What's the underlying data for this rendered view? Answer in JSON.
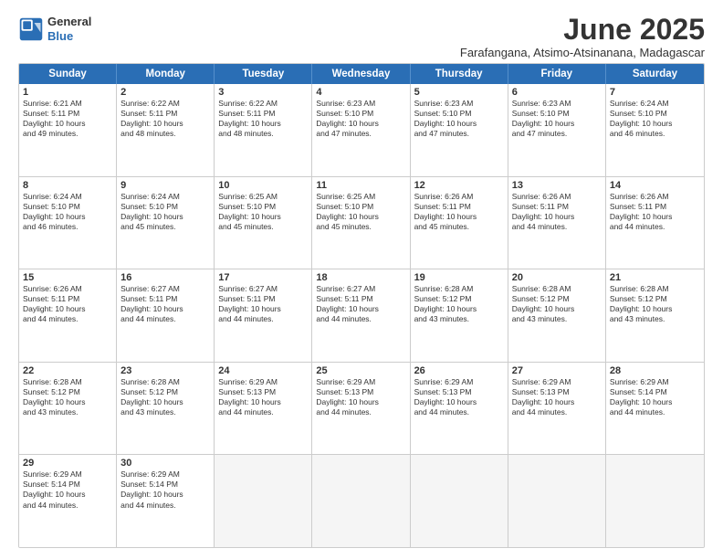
{
  "logo": {
    "general": "General",
    "blue": "Blue"
  },
  "title": "June 2025",
  "subtitle": "Farafangana, Atsimo-Atsinanana, Madagascar",
  "header_days": [
    "Sunday",
    "Monday",
    "Tuesday",
    "Wednesday",
    "Thursday",
    "Friday",
    "Saturday"
  ],
  "weeks": [
    [
      {
        "day": "1",
        "lines": [
          "Sunrise: 6:21 AM",
          "Sunset: 5:11 PM",
          "Daylight: 10 hours",
          "and 49 minutes."
        ]
      },
      {
        "day": "2",
        "lines": [
          "Sunrise: 6:22 AM",
          "Sunset: 5:11 PM",
          "Daylight: 10 hours",
          "and 48 minutes."
        ]
      },
      {
        "day": "3",
        "lines": [
          "Sunrise: 6:22 AM",
          "Sunset: 5:11 PM",
          "Daylight: 10 hours",
          "and 48 minutes."
        ]
      },
      {
        "day": "4",
        "lines": [
          "Sunrise: 6:23 AM",
          "Sunset: 5:10 PM",
          "Daylight: 10 hours",
          "and 47 minutes."
        ]
      },
      {
        "day": "5",
        "lines": [
          "Sunrise: 6:23 AM",
          "Sunset: 5:10 PM",
          "Daylight: 10 hours",
          "and 47 minutes."
        ]
      },
      {
        "day": "6",
        "lines": [
          "Sunrise: 6:23 AM",
          "Sunset: 5:10 PM",
          "Daylight: 10 hours",
          "and 47 minutes."
        ]
      },
      {
        "day": "7",
        "lines": [
          "Sunrise: 6:24 AM",
          "Sunset: 5:10 PM",
          "Daylight: 10 hours",
          "and 46 minutes."
        ]
      }
    ],
    [
      {
        "day": "8",
        "lines": [
          "Sunrise: 6:24 AM",
          "Sunset: 5:10 PM",
          "Daylight: 10 hours",
          "and 46 minutes."
        ]
      },
      {
        "day": "9",
        "lines": [
          "Sunrise: 6:24 AM",
          "Sunset: 5:10 PM",
          "Daylight: 10 hours",
          "and 45 minutes."
        ]
      },
      {
        "day": "10",
        "lines": [
          "Sunrise: 6:25 AM",
          "Sunset: 5:10 PM",
          "Daylight: 10 hours",
          "and 45 minutes."
        ]
      },
      {
        "day": "11",
        "lines": [
          "Sunrise: 6:25 AM",
          "Sunset: 5:10 PM",
          "Daylight: 10 hours",
          "and 45 minutes."
        ]
      },
      {
        "day": "12",
        "lines": [
          "Sunrise: 6:26 AM",
          "Sunset: 5:11 PM",
          "Daylight: 10 hours",
          "and 45 minutes."
        ]
      },
      {
        "day": "13",
        "lines": [
          "Sunrise: 6:26 AM",
          "Sunset: 5:11 PM",
          "Daylight: 10 hours",
          "and 44 minutes."
        ]
      },
      {
        "day": "14",
        "lines": [
          "Sunrise: 6:26 AM",
          "Sunset: 5:11 PM",
          "Daylight: 10 hours",
          "and 44 minutes."
        ]
      }
    ],
    [
      {
        "day": "15",
        "lines": [
          "Sunrise: 6:26 AM",
          "Sunset: 5:11 PM",
          "Daylight: 10 hours",
          "and 44 minutes."
        ]
      },
      {
        "day": "16",
        "lines": [
          "Sunrise: 6:27 AM",
          "Sunset: 5:11 PM",
          "Daylight: 10 hours",
          "and 44 minutes."
        ]
      },
      {
        "day": "17",
        "lines": [
          "Sunrise: 6:27 AM",
          "Sunset: 5:11 PM",
          "Daylight: 10 hours",
          "and 44 minutes."
        ]
      },
      {
        "day": "18",
        "lines": [
          "Sunrise: 6:27 AM",
          "Sunset: 5:11 PM",
          "Daylight: 10 hours",
          "and 44 minutes."
        ]
      },
      {
        "day": "19",
        "lines": [
          "Sunrise: 6:28 AM",
          "Sunset: 5:12 PM",
          "Daylight: 10 hours",
          "and 43 minutes."
        ]
      },
      {
        "day": "20",
        "lines": [
          "Sunrise: 6:28 AM",
          "Sunset: 5:12 PM",
          "Daylight: 10 hours",
          "and 43 minutes."
        ]
      },
      {
        "day": "21",
        "lines": [
          "Sunrise: 6:28 AM",
          "Sunset: 5:12 PM",
          "Daylight: 10 hours",
          "and 43 minutes."
        ]
      }
    ],
    [
      {
        "day": "22",
        "lines": [
          "Sunrise: 6:28 AM",
          "Sunset: 5:12 PM",
          "Daylight: 10 hours",
          "and 43 minutes."
        ]
      },
      {
        "day": "23",
        "lines": [
          "Sunrise: 6:28 AM",
          "Sunset: 5:12 PM",
          "Daylight: 10 hours",
          "and 43 minutes."
        ]
      },
      {
        "day": "24",
        "lines": [
          "Sunrise: 6:29 AM",
          "Sunset: 5:13 PM",
          "Daylight: 10 hours",
          "and 44 minutes."
        ]
      },
      {
        "day": "25",
        "lines": [
          "Sunrise: 6:29 AM",
          "Sunset: 5:13 PM",
          "Daylight: 10 hours",
          "and 44 minutes."
        ]
      },
      {
        "day": "26",
        "lines": [
          "Sunrise: 6:29 AM",
          "Sunset: 5:13 PM",
          "Daylight: 10 hours",
          "and 44 minutes."
        ]
      },
      {
        "day": "27",
        "lines": [
          "Sunrise: 6:29 AM",
          "Sunset: 5:13 PM",
          "Daylight: 10 hours",
          "and 44 minutes."
        ]
      },
      {
        "day": "28",
        "lines": [
          "Sunrise: 6:29 AM",
          "Sunset: 5:14 PM",
          "Daylight: 10 hours",
          "and 44 minutes."
        ]
      }
    ],
    [
      {
        "day": "29",
        "lines": [
          "Sunrise: 6:29 AM",
          "Sunset: 5:14 PM",
          "Daylight: 10 hours",
          "and 44 minutes."
        ]
      },
      {
        "day": "30",
        "lines": [
          "Sunrise: 6:29 AM",
          "Sunset: 5:14 PM",
          "Daylight: 10 hours",
          "and 44 minutes."
        ]
      },
      {
        "day": "",
        "lines": []
      },
      {
        "day": "",
        "lines": []
      },
      {
        "day": "",
        "lines": []
      },
      {
        "day": "",
        "lines": []
      },
      {
        "day": "",
        "lines": []
      }
    ]
  ]
}
